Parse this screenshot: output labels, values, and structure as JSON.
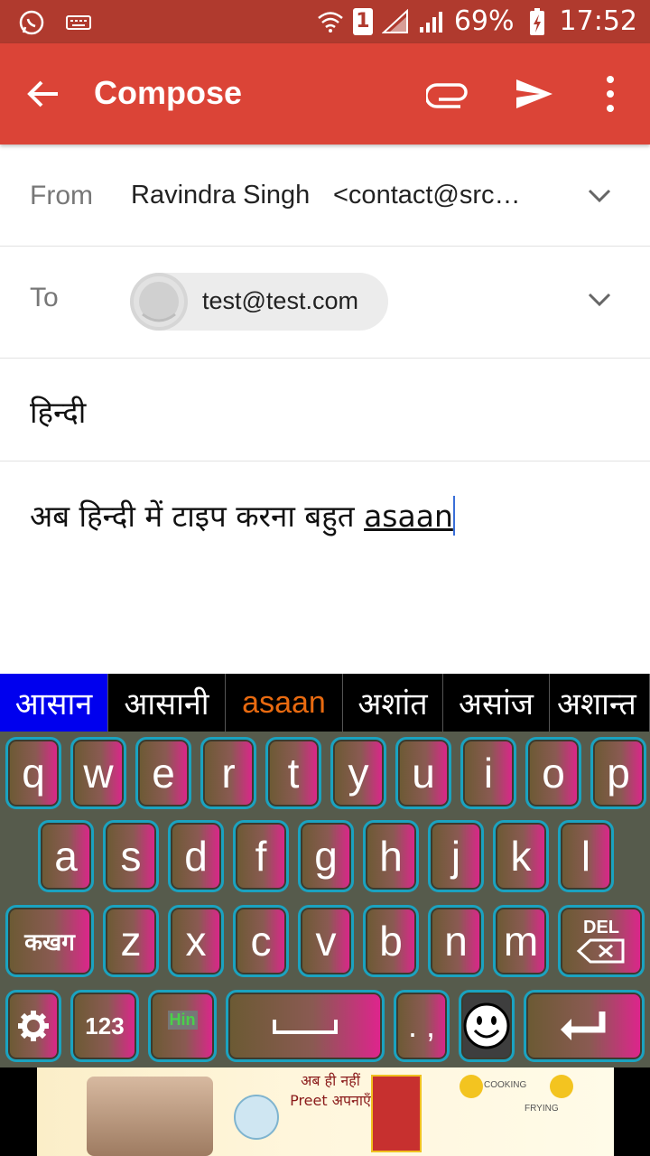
{
  "status_bar": {
    "battery_percent": "69%",
    "time": "17:52",
    "sim_badge": "1",
    "icons": [
      "whatsapp-icon",
      "keyboard-icon",
      "wifi-icon",
      "sim-icon",
      "signal-icon",
      "battery-charging-icon"
    ]
  },
  "appbar": {
    "title": "Compose",
    "color": "#db4437",
    "actions": [
      "attach-icon",
      "send-icon",
      "more-vert-icon"
    ]
  },
  "from": {
    "label": "From",
    "name": "Ravindra Singh",
    "email": "<contact@src…"
  },
  "to": {
    "label": "To",
    "recipient": "test@test.com"
  },
  "subject": "हिन्दी",
  "body": {
    "text": "अब हिन्दी में टाइप करना बहुत ",
    "typed": "asaan"
  },
  "suggestions": [
    "आसान",
    "आसानी",
    "asaan",
    "अशांत",
    "असांज",
    "अशान्त"
  ],
  "keyboard": {
    "row1": [
      "q",
      "w",
      "e",
      "r",
      "t",
      "y",
      "u",
      "i",
      "o",
      "p"
    ],
    "row2": [
      "a",
      "s",
      "d",
      "f",
      "g",
      "h",
      "j",
      "k",
      "l"
    ],
    "row3": [
      "कखग",
      "z",
      "x",
      "c",
      "v",
      "b",
      "n",
      "m",
      "DEL"
    ],
    "row4": {
      "numbers": "123",
      "lang": "Hin",
      "punct": ". ,"
    }
  },
  "ad": {
    "hindi_line": "अब ही नहीं Preet अपनाएँ",
    "label_cooking": "COOKING",
    "label_frying": "FRYING"
  }
}
